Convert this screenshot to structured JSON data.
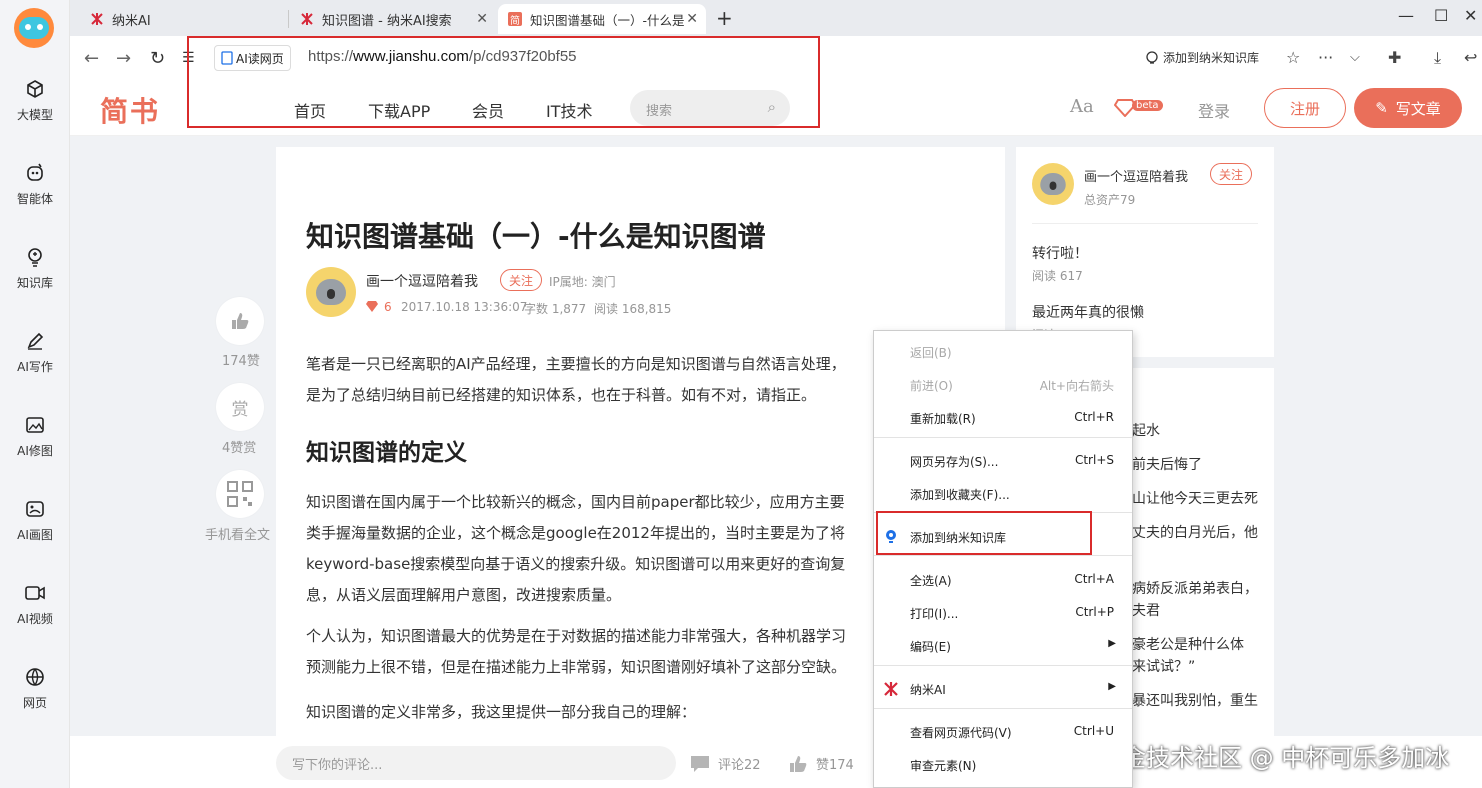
{
  "sidebar": {
    "items": [
      {
        "label": "大模型",
        "icon": "cube-icon"
      },
      {
        "label": "智能体",
        "icon": "agent-icon"
      },
      {
        "label": "知识库",
        "icon": "lightbulb-icon"
      },
      {
        "label": "AI写作",
        "icon": "pen-icon"
      },
      {
        "label": "AI修图",
        "icon": "image-edit-icon"
      },
      {
        "label": "AI画图",
        "icon": "palette-icon"
      },
      {
        "label": "AI视频",
        "icon": "video-icon"
      },
      {
        "label": "网页",
        "icon": "globe-icon"
      }
    ]
  },
  "tabs": [
    {
      "label": "纳米AI"
    },
    {
      "label": "知识图谱 - 纳米AI搜索"
    },
    {
      "label": "知识图谱基础（一）-什么是"
    }
  ],
  "addressbar": {
    "ai_read": "AI读网页",
    "url_prefix": "https://",
    "url_domain": "www.jianshu.com",
    "url_path": "/p/cd937f20bf55",
    "add_kb": "添加到纳米知识库"
  },
  "jianshu": {
    "logo": "简书",
    "nav": [
      "首页",
      "下载APP",
      "会员",
      "IT技术"
    ],
    "search_placeholder": "搜索",
    "aa": "Aa",
    "beta": "beta",
    "login": "登录",
    "register": "注册",
    "write": "写文章"
  },
  "article": {
    "title": "知识图谱基础（一）-什么是知识图谱",
    "author": "画一个逗逗陪着我",
    "follow": "关注",
    "ip": "IP属地: 澳门",
    "diamonds": "6",
    "date": "2017.10.18 13:36:07",
    "words": "字数 1,877",
    "reads": "阅读 168,815",
    "p1": [
      "笔者是一只已经离职的AI产品经理，主要擅长的方向是知识图谱与自然语言处理，",
      "是为了总结归纳目前已经搭建的知识体系，也在于科普。如有不对，请指正。"
    ],
    "h2": "知识图谱的定义",
    "p2": [
      "知识图谱在国内属于一个比较新兴的概念，国内目前paper都比较少，应用方主要",
      "类手握海量数据的企业，这个概念是google在2012年提出的，当时主要是为了将",
      "keyword-base搜索模型向基于语义的搜索升级。知识图谱可以用来更好的查询复",
      "息，从语义层面理解用户意图，改进搜索质量。"
    ],
    "p3": [
      "个人认为，知识图谱最大的优势是在于对数据的描述能力非常强大，各种机器学习",
      "预测能力上很不错，但是在描述能力上非常弱，知识图谱刚好填补了这部分空缺。"
    ],
    "p4": "知识图谱的定义非常多，我这里提供一部分我自己的理解："
  },
  "float": {
    "likes": "174赞",
    "reward_icon": "赏",
    "rewards": "4赞赏",
    "mobile": "手机看全文"
  },
  "side": {
    "author": "画一个逗逗陪着我",
    "follow": "关注",
    "assets": "总资产79",
    "post1": "转行啦！",
    "post1_reads": "阅读 617",
    "post2": "最近两年真的很懒",
    "post2_reads": "阅读",
    "list": [
      "起水",
      "前夫后悔了",
      "山让他今天三更去死",
      "丈夫的白月光后，他",
      "",
      "病娇反派弟弟表白，",
      "夫君",
      "豪老公是种什么体",
      "来试试？”",
      "暴还叫我别怕，重生"
    ]
  },
  "bottom": {
    "placeholder": "写下你的评论...",
    "comments": "评论22",
    "likes": "赞174"
  },
  "watermark": "掘金技术社区 @ 中杯可乐多加冰",
  "context_menu": [
    {
      "label": "返回(B)",
      "shortcut": "",
      "disabled": true
    },
    {
      "label": "前进(O)",
      "shortcut": "Alt+向右箭头",
      "disabled": true
    },
    {
      "label": "重新加载(R)",
      "shortcut": "Ctrl+R",
      "disabled": false
    },
    {
      "label": "网页另存为(S)...",
      "shortcut": "Ctrl+S",
      "disabled": false
    },
    {
      "label": "添加到收藏夹(F)...",
      "shortcut": "",
      "disabled": false
    },
    {
      "label": "添加到纳米知识库",
      "shortcut": "",
      "disabled": false
    },
    {
      "label": "全选(A)",
      "shortcut": "Ctrl+A",
      "disabled": false
    },
    {
      "label": "打印(I)...",
      "shortcut": "Ctrl+P",
      "disabled": false
    },
    {
      "label": "编码(E)",
      "shortcut": "",
      "disabled": false
    },
    {
      "label": "纳米AI",
      "shortcut": "",
      "disabled": false
    },
    {
      "label": "查看网页源代码(V)",
      "shortcut": "Ctrl+U",
      "disabled": false
    },
    {
      "label": "审查元素(N)",
      "shortcut": "",
      "disabled": false
    }
  ],
  "colors": {
    "jianshu_accent": "#ea6f5a",
    "highlight_box": "#d92b2b"
  }
}
